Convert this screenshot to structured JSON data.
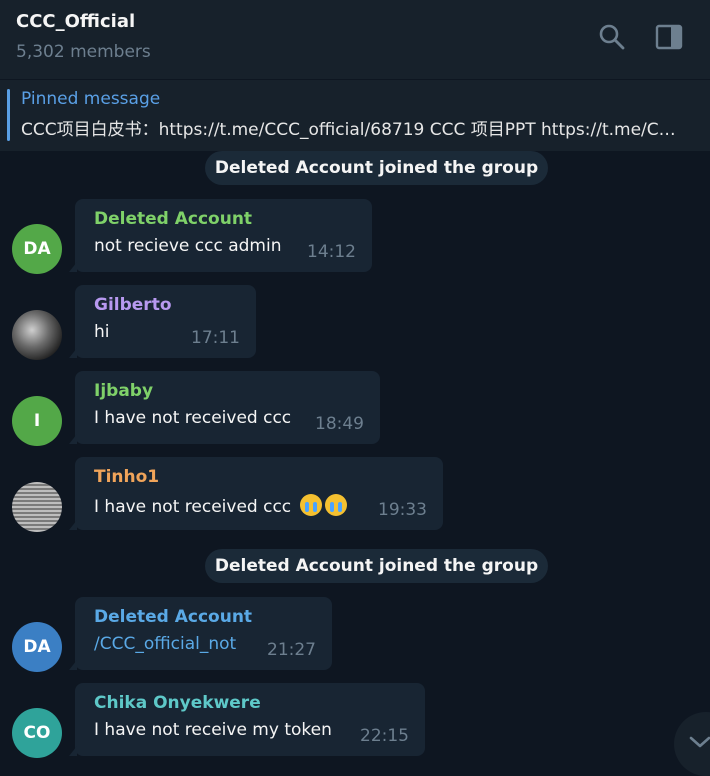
{
  "header": {
    "title": "CCC_Official",
    "subtitle": "5,302 members",
    "icons": [
      "search-icon",
      "sidebar-toggle-icon"
    ]
  },
  "pinned": {
    "title": "Pinned message",
    "text": "CCC项目白皮书：https://t.me/CCC_official/68719  CCC 项目PPT  https://t.me/CCC_official"
  },
  "service": {
    "joined_1": "Deleted Account joined the group",
    "joined_2": "Deleted Account joined the group"
  },
  "messages": [
    {
      "avatar": "DA",
      "sender": "Deleted Account",
      "text": "not recieve ccc admin",
      "time": "14:12",
      "color": "#7fd169",
      "avatar_color": "#53a848"
    },
    {
      "avatar": "",
      "sender": "Gilberto",
      "text": "hi",
      "time": "17:11",
      "color": "#b799f0",
      "avatar_color": "#444"
    },
    {
      "avatar": "I",
      "sender": "Ijbaby",
      "text": "I have not received ccc",
      "time": "18:49",
      "color": "#7fd169",
      "avatar_color": "#53a848"
    },
    {
      "avatar": "",
      "sender": "Tinho1",
      "text": "I have not received ccc",
      "time": "19:33",
      "color": "#f0a45a",
      "avatar_color": "#777"
    },
    {
      "avatar": "DA",
      "sender": "Deleted Account",
      "text": "/CCC_official_not",
      "time": "21:27",
      "color": "#5aa9e6",
      "avatar_color": "#3b7fc4"
    },
    {
      "avatar": "CO",
      "sender": "Chika Onyekwere",
      "text": "I have not receive my token",
      "time": "22:15",
      "color": "#5ec8c8",
      "avatar_color": "#2fa39a"
    }
  ]
}
